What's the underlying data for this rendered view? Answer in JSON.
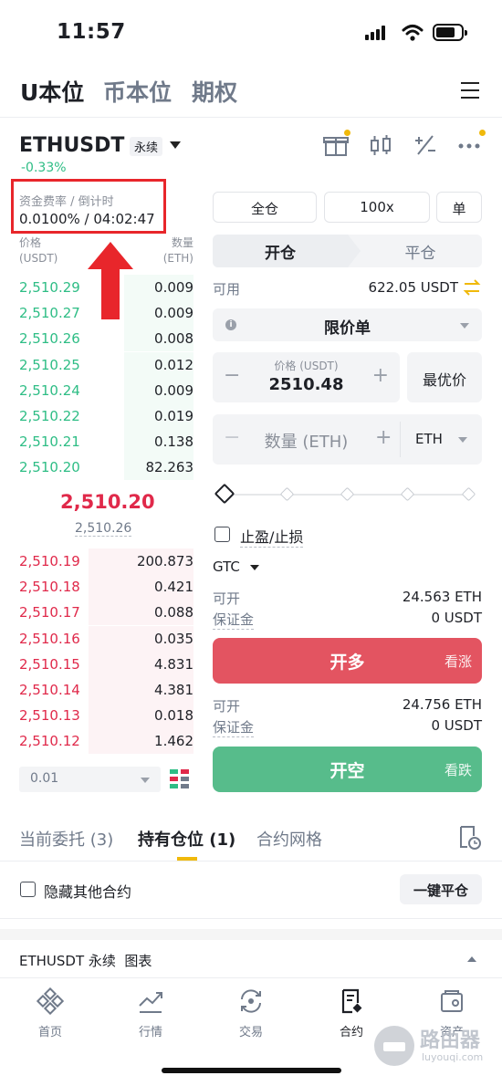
{
  "status_bar": {
    "time": "11:57"
  },
  "tabs": [
    {
      "label": "U本位"
    },
    {
      "label": "币本位"
    },
    {
      "label": "期权"
    }
  ],
  "market": {
    "symbol": "ETHUSDT",
    "perp_tag": "永续",
    "change": "-0.33%",
    "funding_label": "资金费率 / 倒计时",
    "funding_value": "0.0100% / 04:02:47"
  },
  "orderbook": {
    "price_header": "价格",
    "price_unit": "(USDT)",
    "qty_header": "数量",
    "qty_unit": "(ETH)",
    "asks": [
      {
        "price": "2,510.29",
        "qty": "0.009",
        "depth": 0.4
      },
      {
        "price": "2,510.27",
        "qty": "0.009",
        "depth": 0.4
      },
      {
        "price": "2,510.26",
        "qty": "0.008",
        "depth": 0.4
      },
      {
        "price": "2,510.25",
        "qty": "0.012",
        "depth": 0.4
      },
      {
        "price": "2,510.24",
        "qty": "0.009",
        "depth": 0.4
      },
      {
        "price": "2,510.22",
        "qty": "0.019",
        "depth": 0.4
      },
      {
        "price": "2,510.21",
        "qty": "0.138",
        "depth": 0.4
      },
      {
        "price": "2,510.20",
        "qty": "82.263",
        "depth": 0.4
      }
    ],
    "mid_price": "2,510.20",
    "mark_price": "2,510.26",
    "bids": [
      {
        "price": "2,510.19",
        "qty": "200.873",
        "depth": 0.6
      },
      {
        "price": "2,510.18",
        "qty": "0.421",
        "depth": 0.6
      },
      {
        "price": "2,510.17",
        "qty": "0.088",
        "depth": 0.6
      },
      {
        "price": "2,510.16",
        "qty": "0.035",
        "depth": 0.6
      },
      {
        "price": "2,510.15",
        "qty": "4.831",
        "depth": 0.6
      },
      {
        "price": "2,510.14",
        "qty": "4.381",
        "depth": 0.6
      },
      {
        "price": "2,510.13",
        "qty": "0.018",
        "depth": 0.6
      },
      {
        "price": "2,510.12",
        "qty": "1.462",
        "depth": 0.6
      }
    ],
    "precision": "0.01"
  },
  "trade": {
    "margin_mode": "全仓",
    "leverage": "100x",
    "position_mode": "单",
    "open_tab": "开仓",
    "close_tab": "平仓",
    "available_label": "可用",
    "available_value": "622.05 USDT",
    "order_type": "限价单",
    "price_label": "价格 (USDT)",
    "price_value": "2510.48",
    "best_price": "最优价",
    "qty_placeholder": "数量 (ETH)",
    "qty_unit": "ETH",
    "tpsl_label": "止盈/止损",
    "tif": "GTC",
    "long": {
      "can_open_label": "可开",
      "can_open_value": "24.563 ETH",
      "margin_label": "保证金",
      "margin_value": "0 USDT",
      "button": "开多",
      "button_sub": "看涨"
    },
    "short": {
      "can_open_label": "可开",
      "can_open_value": "24.756 ETH",
      "margin_label": "保证金",
      "margin_value": "0 USDT",
      "button": "开空",
      "button_sub": "看跌"
    }
  },
  "positions": {
    "tabs": [
      {
        "label": "当前委托 (3)"
      },
      {
        "label": "持有仓位 (1)"
      },
      {
        "label": "合约网格"
      }
    ],
    "hide_others": "隐藏其他合约",
    "close_all": "一键平仓",
    "chart_row": "ETHUSDT 永续  图表"
  },
  "bottom_nav": [
    {
      "label": "首页"
    },
    {
      "label": "行情"
    },
    {
      "label": "交易"
    },
    {
      "label": "合约"
    },
    {
      "label": "资产"
    }
  ],
  "watermark": {
    "text": "路由器",
    "sub": "luyouqi.com"
  },
  "colors": {
    "green": "#2ebd85",
    "red": "#e0294a",
    "long_button": "#e35461",
    "short_button": "#57bc8b",
    "accent": "#f0b90b"
  }
}
